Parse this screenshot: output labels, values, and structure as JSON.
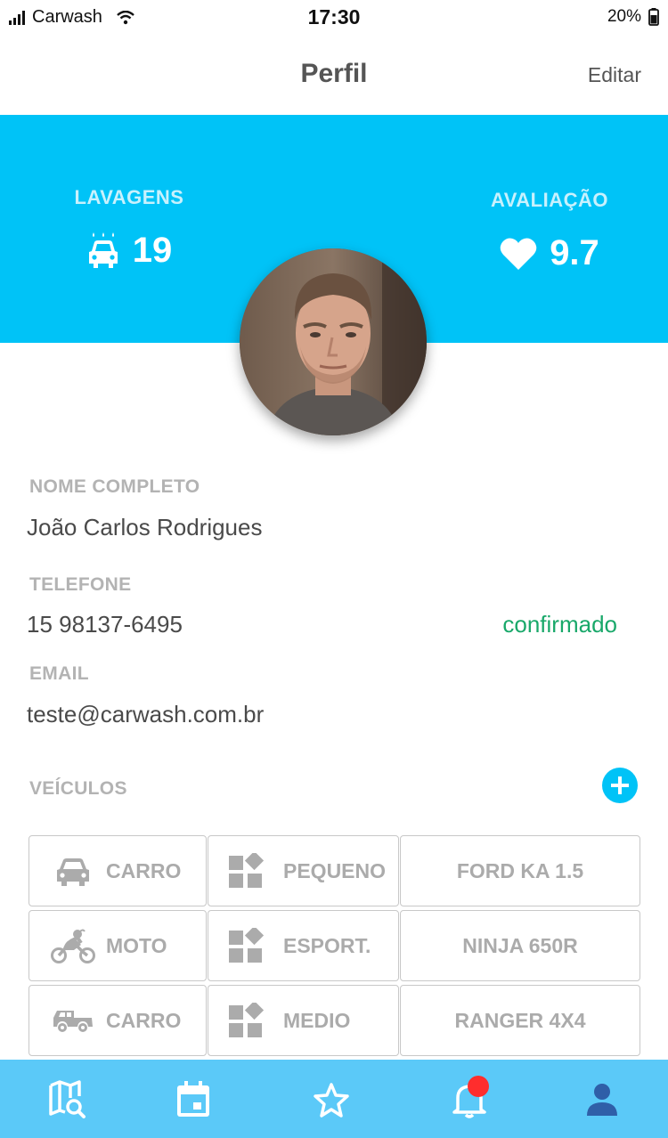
{
  "status_bar": {
    "carrier": "Carwash",
    "time": "17:30",
    "battery": "20%"
  },
  "header": {
    "title": "Perfil",
    "edit_label": "Editar"
  },
  "stats": {
    "washes": {
      "label": "LAVAGENS",
      "value": "19",
      "icon": "car-wash-icon"
    },
    "rating": {
      "label": "AVALIAÇÃO",
      "value": "9.7",
      "icon": "heart-icon"
    }
  },
  "profile": {
    "name_label": "NOME COMPLETO",
    "name": "João Carlos Rodrigues",
    "phone_label": "TELEFONE",
    "phone": "15 98137-6495",
    "phone_status": "confirmado",
    "email_label": "EMAIL",
    "email": "teste@carwash.com.br"
  },
  "vehicles": {
    "label": "VEÍCULOS",
    "rows": [
      {
        "type": "CARRO",
        "type_icon": "car-icon",
        "size": "PEQUENO",
        "model": "FORD KA 1.5"
      },
      {
        "type": "MOTO",
        "type_icon": "motorcycle-icon",
        "size": "ESPORT.",
        "model": "NINJA 650R"
      },
      {
        "type": "CARRO",
        "type_icon": "pickup-icon",
        "size": "MEDIO",
        "model": "RANGER 4X4"
      }
    ]
  },
  "tabbar": {
    "items": [
      "map-search-icon",
      "calendar-icon",
      "star-icon",
      "bell-icon",
      "user-icon"
    ],
    "active": "user-icon"
  },
  "colors": {
    "accent": "#00c3f7",
    "tabbar": "#5bc9f8",
    "confirmed": "#19a86a",
    "badge": "#ff2d2d",
    "active_tab": "#2f5fa8"
  }
}
